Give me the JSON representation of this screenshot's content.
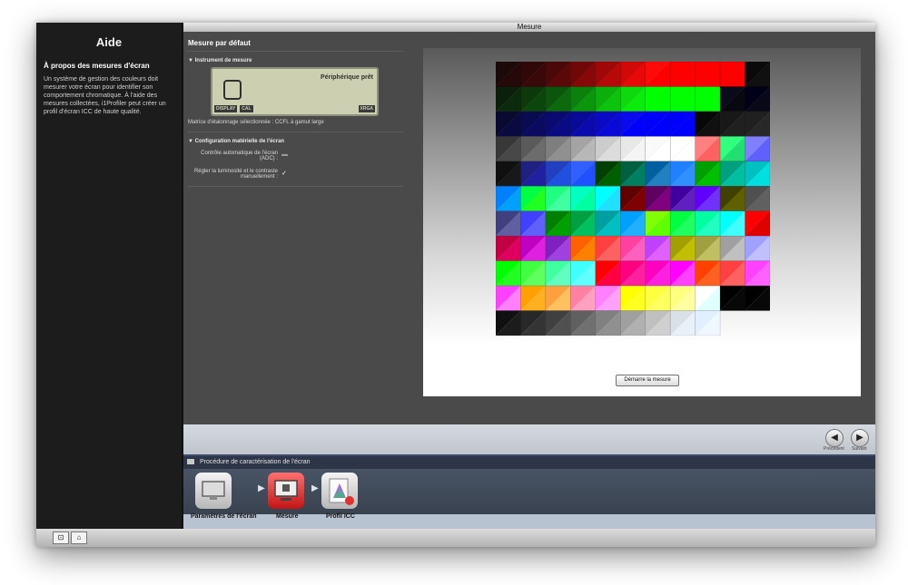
{
  "window": {
    "title": "Mesure"
  },
  "help": {
    "title": "Aide",
    "subtitle": "À propos des mesures d'écran",
    "body": "Un système de gestion des couleurs doit mesurer votre écran pour identifier son comportement chromatique. À l'aide des mesures collectées, i1Profiler peut créer un profil d'écran ICC de haute qualité."
  },
  "main": {
    "section_title": "Mesure par défaut",
    "instrument": {
      "heading": "Instrument de mesure",
      "status": "Périphérique prêt",
      "chips": [
        "DISPLAY",
        "CAL",
        "XRGA"
      ],
      "matrix_label": "Matrice d'étalonnage sélectionnée :",
      "matrix_value": "CCFL à gamut large"
    },
    "hardware": {
      "heading": "Configuration matérielle de l'écran",
      "adc_label": "Contrôle automatique de l'écran (ADC) :",
      "manual_label": "Régler la luminosité et le contraste manuellement :"
    },
    "start_button": "Démarre la mesure"
  },
  "nav": {
    "prev_label": "Précédent",
    "next_label": "Suivant"
  },
  "workflow": {
    "header": "Procédure de caractérisation de l'écran",
    "steps": [
      {
        "label": "Paramètres de l'écran"
      },
      {
        "label": "Mesure"
      },
      {
        "label": "Profil ICC"
      }
    ]
  },
  "patch_grid": {
    "columns": 11,
    "rows": [
      [
        [
          "#1c0a0a",
          "#250808"
        ],
        [
          "#300808",
          "#3a0808"
        ],
        [
          "#4a0808",
          "#5a0808"
        ],
        [
          "#700808",
          "#880808"
        ],
        [
          "#a00808",
          "#b80808"
        ],
        [
          "#d00808",
          "#e80808"
        ],
        [
          "#ff0a0a",
          "#ff0000"
        ],
        [
          "#ff0000",
          "#ff0000"
        ],
        [
          "#ff0000",
          "#ff0000"
        ],
        [
          "#ff0000",
          "#ff0000"
        ],
        [
          "#0a0a0a",
          "#101010"
        ]
      ],
      [
        [
          "#0a200a",
          "#0c2a0c"
        ],
        [
          "#0c380c",
          "#0c460c"
        ],
        [
          "#0c560c",
          "#0c6a0c"
        ],
        [
          "#0c800c",
          "#0c960c"
        ],
        [
          "#0cae0c",
          "#0cc40c"
        ],
        [
          "#0cda0c",
          "#0cec0c"
        ],
        [
          "#00ff00",
          "#00ff00"
        ],
        [
          "#00ff00",
          "#00ff00"
        ],
        [
          "#00ff00",
          "#00ff00"
        ],
        [
          "#0a0a1a",
          "#080810"
        ],
        [
          "#000018",
          "#080818"
        ]
      ],
      [
        [
          "#0a0a30",
          "#0a0a40"
        ],
        [
          "#0a0a50",
          "#0a0a60"
        ],
        [
          "#0a0a70",
          "#0a0a84"
        ],
        [
          "#0a0a98",
          "#0a0aae"
        ],
        [
          "#0a0ac4",
          "#0a0ad8"
        ],
        [
          "#0a0aec",
          "#0000ff"
        ],
        [
          "#0000ff",
          "#0000ff"
        ],
        [
          "#0000ff",
          "#0000ff"
        ],
        [
          "#080808",
          "#101010"
        ],
        [
          "#181818",
          "#202020"
        ],
        [
          "#202020",
          "#282828"
        ]
      ],
      [
        [
          "#383838",
          "#484848"
        ],
        [
          "#5a5a5a",
          "#6c6c6c"
        ],
        [
          "#7e7e7e",
          "#909090"
        ],
        [
          "#a4a4a4",
          "#b8b8b8"
        ],
        [
          "#cccccc",
          "#dcdcdc"
        ],
        [
          "#e8e8e8",
          "#f4f4f4"
        ],
        [
          "#fafafa",
          "#ffffff"
        ],
        [
          "#ffffff",
          "#ffffff"
        ],
        [
          "#ff8080",
          "#ff6060"
        ],
        [
          "#30ff80",
          "#20e070"
        ],
        [
          "#8080ff",
          "#6060ff"
        ]
      ],
      [
        [
          "#101010",
          "#181818"
        ],
        [
          "#202080",
          "#2020a0"
        ],
        [
          "#2040c0",
          "#2050e0"
        ],
        [
          "#3060ff",
          "#2050ff"
        ],
        [
          "#004000",
          "#006000"
        ],
        [
          "#006040",
          "#008060"
        ],
        [
          "#0060a0",
          "#2080c0"
        ],
        [
          "#2080ff",
          "#3090ff"
        ],
        [
          "#00a000",
          "#00c000"
        ],
        [
          "#00a080",
          "#00c0a0"
        ],
        [
          "#00c0c0",
          "#00e0e0"
        ]
      ],
      [
        [
          "#0080ff",
          "#00a0ff"
        ],
        [
          "#00ff40",
          "#20ff20"
        ],
        [
          "#20ff80",
          "#40ffa0"
        ],
        [
          "#00ffc0",
          "#00ffa0"
        ],
        [
          "#00ffff",
          "#20e0ff"
        ],
        [
          "#600000",
          "#800000"
        ],
        [
          "#600060",
          "#800080"
        ],
        [
          "#4000a0",
          "#6020c0"
        ],
        [
          "#6000ff",
          "#7030ff"
        ],
        [
          "#404000",
          "#606000"
        ],
        [
          "#505050",
          "#606060"
        ]
      ],
      [
        [
          "#404080",
          "#6060a0"
        ],
        [
          "#4040ff",
          "#6060ff"
        ],
        [
          "#008000",
          "#00a000"
        ],
        [
          "#00a040",
          "#00c060"
        ],
        [
          "#00a0a0",
          "#00c0c0"
        ],
        [
          "#00a0ff",
          "#20b0ff"
        ],
        [
          "#80ff00",
          "#60ff00"
        ],
        [
          "#00ff40",
          "#20ff60"
        ],
        [
          "#00ffa0",
          "#20ffc0"
        ],
        [
          "#00ffff",
          "#40ffff"
        ],
        [
          "#ff0000",
          "#e00000"
        ]
      ],
      [
        [
          "#c00040",
          "#e00060"
        ],
        [
          "#c000c0",
          "#e020e0"
        ],
        [
          "#8020c0",
          "#a040e0"
        ],
        [
          "#ff6000",
          "#ff8000"
        ],
        [
          "#ff4040",
          "#ff6060"
        ],
        [
          "#ff40a0",
          "#ff60c0"
        ],
        [
          "#c040ff",
          "#e060ff"
        ],
        [
          "#a0a000",
          "#c0c000"
        ],
        [
          "#a0a040",
          "#c0c060"
        ],
        [
          "#a0a0a0",
          "#c0c0c0"
        ],
        [
          "#a0a0ff",
          "#c0c0ff"
        ]
      ],
      [
        [
          "#00ff00",
          "#20ff20"
        ],
        [
          "#40ff40",
          "#60ff60"
        ],
        [
          "#40ffa0",
          "#60ffc0"
        ],
        [
          "#40ffff",
          "#60ffff"
        ],
        [
          "#ff0000",
          "#ff0040"
        ],
        [
          "#ff0080",
          "#ff20a0"
        ],
        [
          "#ff00c0",
          "#ff20e0"
        ],
        [
          "#ff00ff",
          "#ff40ff"
        ],
        [
          "#ff4000",
          "#ff6020"
        ],
        [
          "#ff4040",
          "#ff6060"
        ],
        [
          "#ff40ff",
          "#ff60ff"
        ]
      ],
      [
        [
          "#ff40ff",
          "#ff80ff"
        ],
        [
          "#ffa000",
          "#ffb020"
        ],
        [
          "#ffa040",
          "#ffc060"
        ],
        [
          "#ff80a0",
          "#ffa0c0"
        ],
        [
          "#ff80ff",
          "#ffa0ff"
        ],
        [
          "#ffff00",
          "#ffff20"
        ],
        [
          "#ffff40",
          "#ffff60"
        ],
        [
          "#ffff80",
          "#ffffa0"
        ],
        [
          "#ffffff",
          "#e0ffff"
        ],
        [
          "#000000",
          "#080808"
        ],
        [
          "#000000",
          "#080808"
        ]
      ],
      [
        [
          "#101010",
          "#1c1c1c"
        ],
        [
          "#282828",
          "#343434"
        ],
        [
          "#404040",
          "#505050"
        ],
        [
          "#606060",
          "#707070"
        ],
        [
          "#808080",
          "#909090"
        ],
        [
          "#a0a0a0",
          "#b0b0b0"
        ],
        [
          "#c0c0c0",
          "#d0d0d0"
        ],
        [
          "#d8e0e8",
          "#e8f0f8"
        ],
        [
          "#e0f0ff",
          "#f0f8ff"
        ]
      ]
    ]
  }
}
